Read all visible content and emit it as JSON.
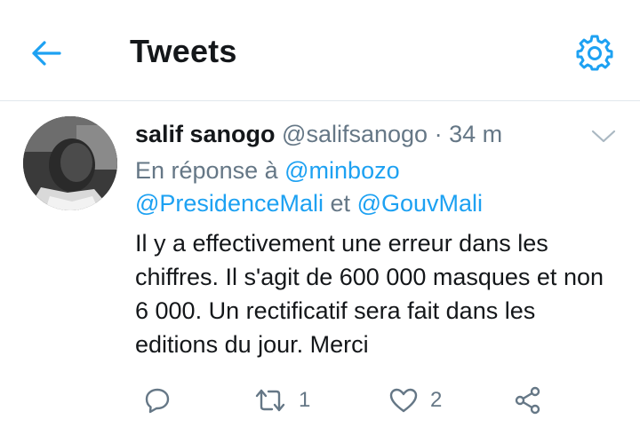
{
  "header": {
    "title": "Tweets",
    "back_icon": "arrow-left-icon",
    "settings_icon": "gear-icon",
    "accent_color": "#1da1f2"
  },
  "tweet": {
    "author_name": "salif sanogo",
    "author_handle": "@salifsanogo",
    "separator": "·",
    "timestamp": "34 m",
    "reply_prefix": "En réponse à",
    "reply_mention_1": "@minbozo",
    "reply_mention_2": "@PresidenceMali",
    "reply_conjunction": "et",
    "reply_mention_3": "@GouvMali",
    "text": "Il y a effectivement une erreur dans les chiffres. Il s'agit de 600 000 masques et non 6 000. Un rectificatif sera fait dans les editions du jour. Merci",
    "actions": {
      "retweet_count": "1",
      "like_count": "2"
    }
  }
}
